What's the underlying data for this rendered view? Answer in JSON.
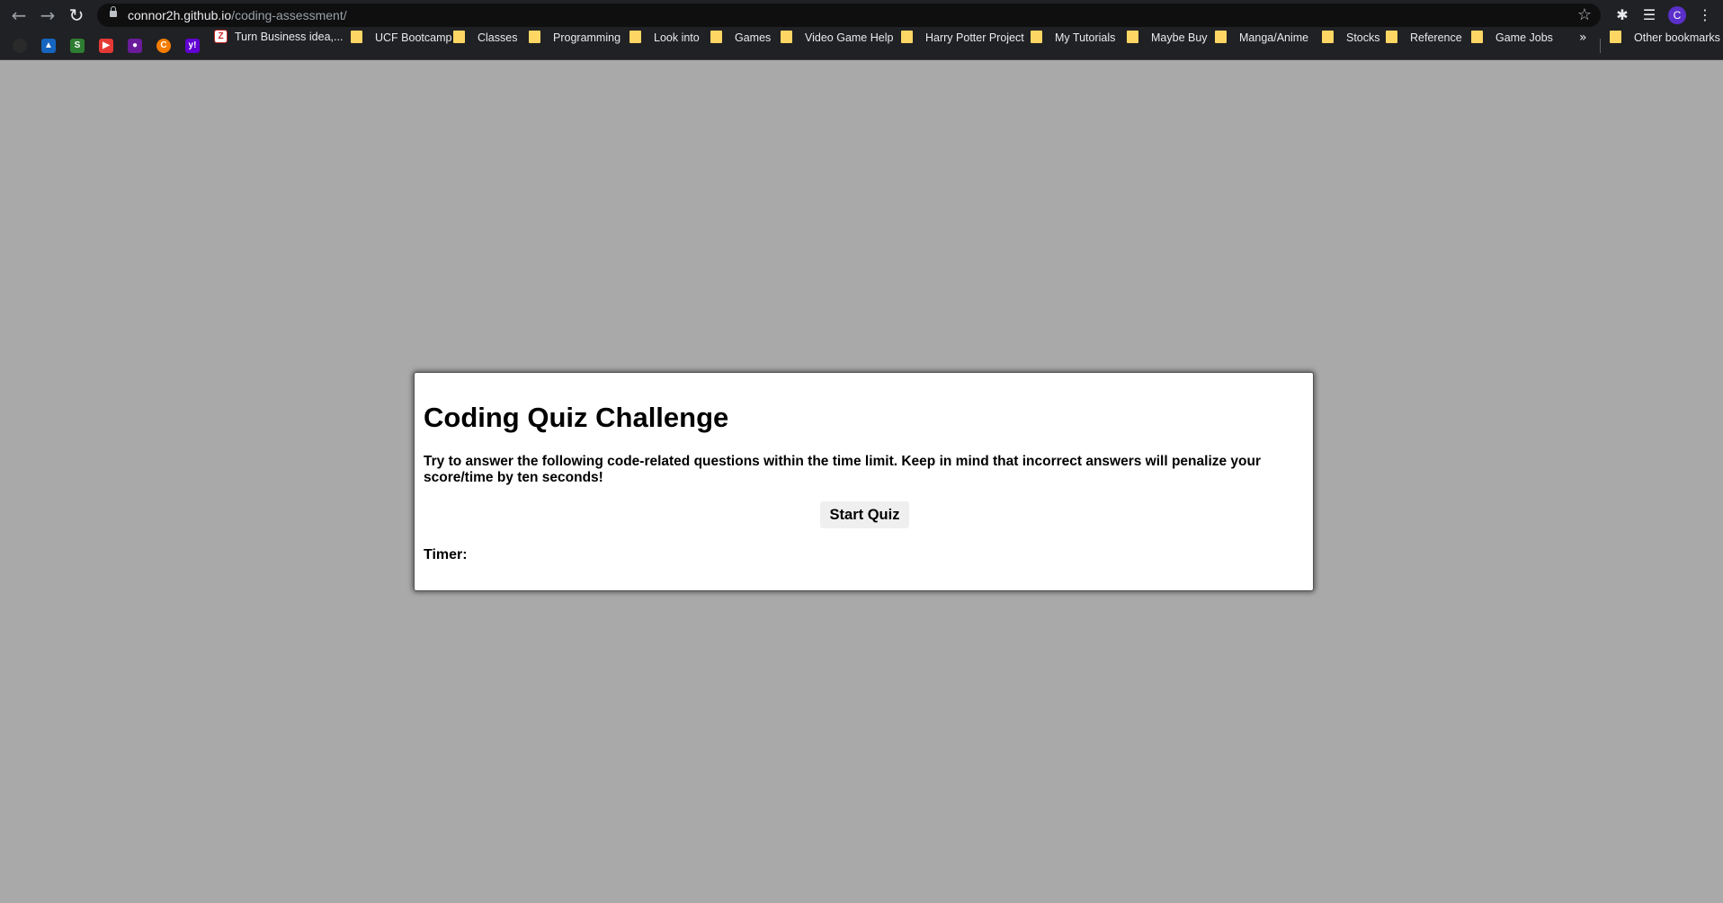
{
  "browser": {
    "url_host": "connor2h.github.io",
    "url_path": "/coding-assessment/",
    "profile_initial": "C",
    "bookmarks": [
      {
        "label": "Turn Business idea,...",
        "type": "link"
      },
      {
        "label": "UCF Bootcamp",
        "type": "folder"
      },
      {
        "label": "Classes",
        "type": "folder"
      },
      {
        "label": "Programming",
        "type": "folder"
      },
      {
        "label": "Look into",
        "type": "folder"
      },
      {
        "label": "Games",
        "type": "folder"
      },
      {
        "label": "Video Game Help",
        "type": "folder"
      },
      {
        "label": "Harry Potter Project",
        "type": "folder"
      },
      {
        "label": "My Tutorials",
        "type": "folder"
      },
      {
        "label": "Maybe Buy",
        "type": "folder"
      },
      {
        "label": "Manga/Anime",
        "type": "folder"
      },
      {
        "label": "Stocks",
        "type": "folder"
      },
      {
        "label": "Reference",
        "type": "folder"
      },
      {
        "label": "Game Jobs",
        "type": "folder"
      }
    ],
    "more_bookmarks": "»",
    "other_bookmarks": "Other bookmarks"
  },
  "quiz": {
    "title": "Coding Quiz Challenge",
    "description": "Try to answer the following code-related questions within the time limit. Keep in mind that incorrect answers will penalize your score/time by ten seconds!",
    "start_label": "Start Quiz",
    "timer_label": "Timer:"
  },
  "colors": {
    "page_background": "#a9a9a9",
    "card_background": "#ffffff",
    "chrome_background": "#202124",
    "folder": "#fdd663"
  }
}
